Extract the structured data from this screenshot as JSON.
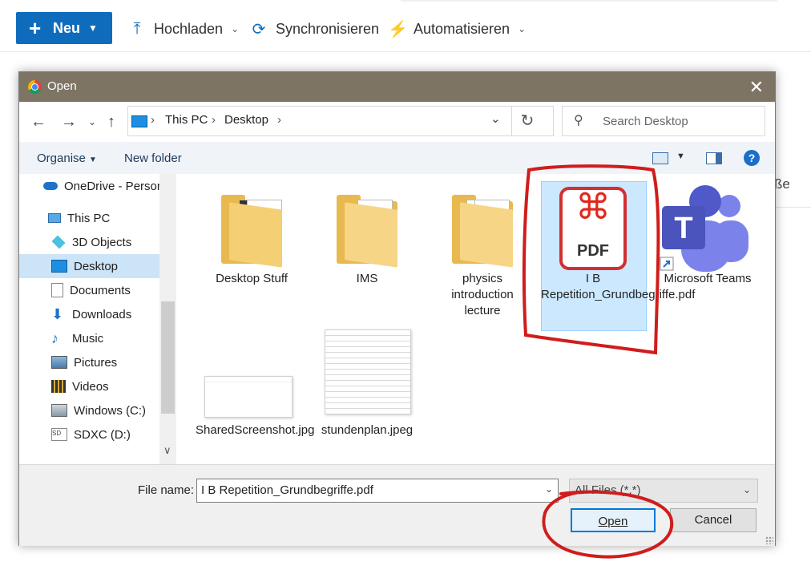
{
  "toolbar": {
    "new_label": "Neu",
    "upload_label": "Hochladen",
    "sync_label": "Synchronisieren",
    "automate_label": "Automatisieren"
  },
  "background": {
    "partial_label": "ße"
  },
  "dialog": {
    "title": "Open",
    "breadcrumb": [
      "This PC",
      "Desktop"
    ],
    "search_placeholder": "Search Desktop",
    "organise_label": "Organise",
    "new_folder_label": "New folder",
    "sidebar": [
      {
        "label": "OneDrive - Person",
        "icon": "cloud-icon"
      },
      {
        "label": "This PC",
        "icon": "pc-icon"
      },
      {
        "label": "3D Objects",
        "icon": "cube-icon"
      },
      {
        "label": "Desktop",
        "icon": "desktop-icon",
        "selected": true
      },
      {
        "label": "Documents",
        "icon": "document-icon"
      },
      {
        "label": "Downloads",
        "icon": "download-icon"
      },
      {
        "label": "Music",
        "icon": "music-icon"
      },
      {
        "label": "Pictures",
        "icon": "pictures-icon"
      },
      {
        "label": "Videos",
        "icon": "video-icon"
      },
      {
        "label": "Windows (C:)",
        "icon": "drive-icon"
      },
      {
        "label": "SDXC (D:)",
        "icon": "sd-card-icon"
      }
    ],
    "files": [
      {
        "name": "Desktop Stuff",
        "type": "folder"
      },
      {
        "name": "IMS",
        "type": "folder"
      },
      {
        "name": "physics introduction lecture",
        "type": "folder"
      },
      {
        "name": "I B Repetition_Grundbegriffe.pdf",
        "type": "pdf",
        "selected": true,
        "icon_text": "PDF"
      },
      {
        "name": "Microsoft Teams",
        "type": "shortcut",
        "icon_text": "T"
      },
      {
        "name": "SharedScreenshot.jpg",
        "type": "image"
      },
      {
        "name": "stundenplan.jpeg",
        "type": "image"
      }
    ],
    "file_name_label": "File name:",
    "file_name_value": "I B Repetition_Grundbegriffe.pdf",
    "file_type_value": "All Files (*.*)",
    "open_label": "Open",
    "cancel_label": "Cancel"
  },
  "colors": {
    "accent": "#0f6cbd",
    "titlebar": "#7d7464",
    "selection": "#cce8ff",
    "annotation": "#d01c1c"
  }
}
